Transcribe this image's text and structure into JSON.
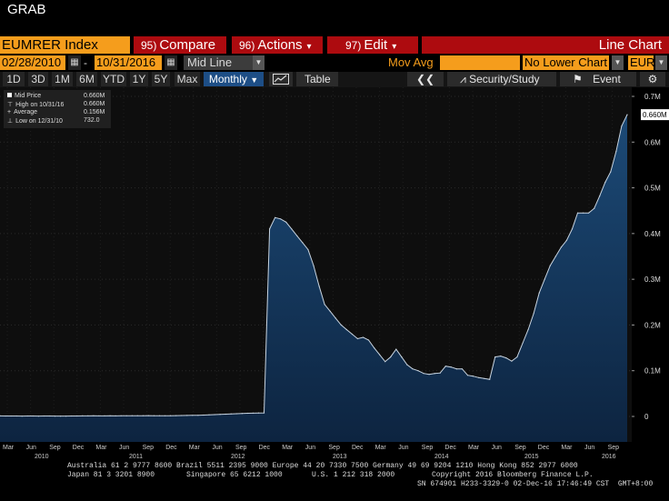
{
  "window": {
    "title": "GRAB"
  },
  "toolbar": {
    "ticker": "EUMRER Index",
    "compare": {
      "num": "95)",
      "label": "Compare"
    },
    "actions": {
      "num": "96)",
      "label": "Actions"
    },
    "edit": {
      "num": "97)",
      "label": "Edit"
    },
    "chart_type": "Line Chart"
  },
  "range": {
    "start": "02/28/2010",
    "end": "10/31/2016",
    "price_field": "Mid Line",
    "mov_avg_label": "Mov Avg",
    "lower_chart": "No Lower Chart",
    "currency": "EUR"
  },
  "periods": [
    "1D",
    "3D",
    "1M",
    "6M",
    "YTD",
    "1Y",
    "5Y",
    "Max"
  ],
  "frequency": "Monthly",
  "tools": {
    "table": "Table",
    "security_study": "Security/Study",
    "event": "Event"
  },
  "legend": {
    "rows": [
      {
        "label": "Mid Price",
        "value": "0.660M"
      },
      {
        "label": "High on 10/31/16",
        "value": "0.660M"
      },
      {
        "label": "Average",
        "value": "0.156M"
      },
      {
        "label": "Low on 12/31/10",
        "value": "732.0"
      }
    ]
  },
  "last_value": "0.660M",
  "colors": {
    "orange": "#f59d1c",
    "red": "#ad0b0f",
    "area_fill": "#12304f",
    "line": "#c8d4e0"
  },
  "footer": {
    "line1": "Australia 61 2 9777 8600 Brazil 5511 2395 9000 Europe 44 20 7330 7500 Germany 49 69 9204 1210 Hong Kong 852 2977 6000",
    "line2a": "Japan 81 3 3201 8900",
    "line2b": "Singapore 65 6212 1000",
    "line2c": "U.S. 1 212 318 2000",
    "line2d": "Copyright 2016 Bloomberg Finance L.P.",
    "line3": "SN 674901 H233-3329-0 02-Dec-16 17:46:49 CST  GMT+8:00"
  },
  "chart_data": {
    "type": "area",
    "title": "",
    "xlabel": "",
    "ylabel": "",
    "ylim": [
      0,
      0.7
    ],
    "y_unit": "M",
    "yticks": [
      "0",
      "0.1M",
      "0.2M",
      "0.3M",
      "0.4M",
      "0.5M",
      "0.6M",
      "0.7M"
    ],
    "x_month_labels": [
      "Mar",
      "Jun",
      "Sep",
      "Dec",
      "Mar",
      "Jun",
      "Sep",
      "Dec",
      "Mar",
      "Jun",
      "Sep",
      "Dec",
      "Mar",
      "Jun",
      "Sep",
      "Dec",
      "Mar",
      "Jun",
      "Sep",
      "Dec",
      "Mar",
      "Jun",
      "Sep",
      "Dec",
      "Mar",
      "Jun",
      "Sep"
    ],
    "x_year_labels": [
      "2010",
      "2011",
      "2012",
      "2013",
      "2014",
      "2015",
      "2016"
    ],
    "series": [
      {
        "values": [
          0.0011,
          0.0009,
          0.001,
          0.0009,
          0.0008,
          0.0009,
          0.0009,
          0.0008,
          0.0009,
          0.0009,
          0.0008,
          0.0007,
          0.0008,
          0.0009,
          0.001,
          0.0012,
          0.0011,
          0.0013,
          0.0012,
          0.0011,
          0.0013,
          0.0012,
          0.0014,
          0.0013,
          0.0015,
          0.0016,
          0.0015,
          0.0017,
          0.0016,
          0.0015,
          0.0014,
          0.0016,
          0.0018,
          0.002,
          0.0022,
          0.0024,
          0.0026,
          0.003,
          0.0035,
          0.004,
          0.0045,
          0.005,
          0.0055,
          0.006,
          0.0065,
          0.007,
          0.0072,
          0.0075,
          0.0078,
          0.41,
          0.435,
          0.432,
          0.425,
          0.41,
          0.395,
          0.38,
          0.365,
          0.33,
          0.285,
          0.245,
          0.23,
          0.215,
          0.2,
          0.19,
          0.18,
          0.17,
          0.173,
          0.167,
          0.15,
          0.135,
          0.12,
          0.13,
          0.147,
          0.13,
          0.113,
          0.104,
          0.1,
          0.094,
          0.092,
          0.094,
          0.095,
          0.11,
          0.108,
          0.104,
          0.104,
          0.09,
          0.088,
          0.085,
          0.083,
          0.081,
          0.13,
          0.132,
          0.128,
          0.121,
          0.13,
          0.16,
          0.19,
          0.225,
          0.27,
          0.3,
          0.33,
          0.35,
          0.37,
          0.385,
          0.41,
          0.445,
          0.445,
          0.445,
          0.455,
          0.482,
          0.512,
          0.535,
          0.58,
          0.635,
          0.66
        ]
      }
    ]
  }
}
